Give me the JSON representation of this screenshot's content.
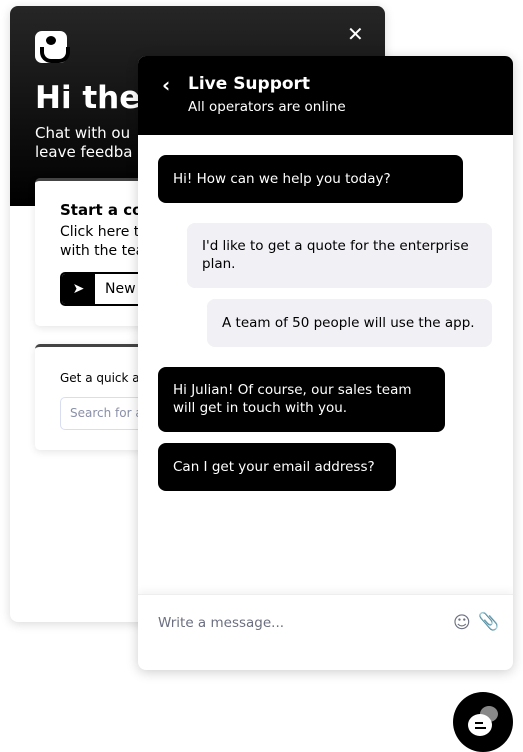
{
  "home": {
    "close_icon": "close-icon",
    "title": "Hi ther",
    "subtitle_lines": [
      "Chat with ou",
      "leave feedba"
    ],
    "start_card": {
      "title": "Start a co",
      "desc_lines": [
        "Click here t",
        "with the tea"
      ],
      "button_label": "New",
      "button_icon": "paper-plane-icon"
    },
    "quick_card": {
      "label": "Get a quick a",
      "search_placeholder": "Search for a"
    }
  },
  "chat": {
    "title": "Live Support",
    "status": "All operators are online",
    "messages": [
      {
        "from": "operator",
        "text": "Hi! How can we help you today?"
      },
      {
        "from": "user",
        "text": "I'd like to get a quote for the enterprise plan."
      },
      {
        "from": "user",
        "text": "A team of 50 people will use the app."
      },
      {
        "from": "operator",
        "text": "Hi Julian! Of course, our sales team will get in touch with you."
      },
      {
        "from": "operator",
        "text": "Can I get your email address?"
      }
    ],
    "input_placeholder": "Write a message..."
  },
  "colors": {
    "operator_bubble": "#000000",
    "user_bubble": "#f0f0f5"
  }
}
